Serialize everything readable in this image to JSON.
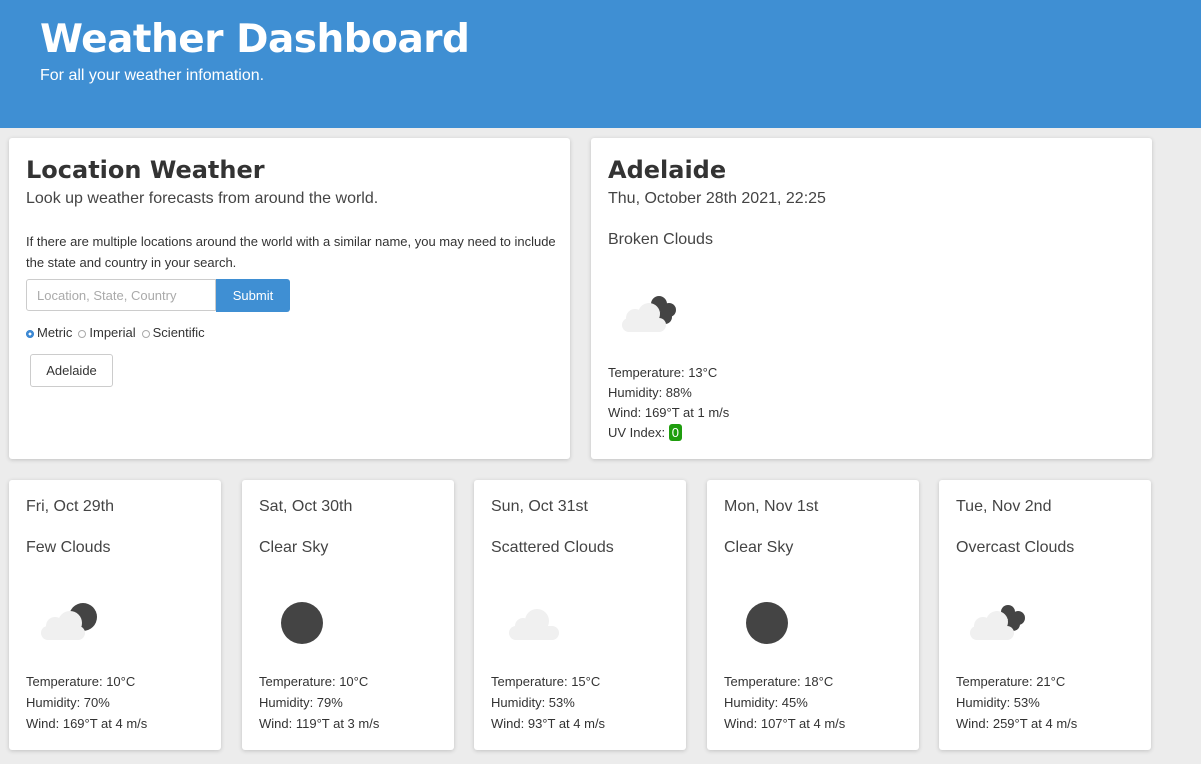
{
  "header": {
    "title": "Weather Dashboard",
    "subtitle": "For all your weather infomation."
  },
  "location_card": {
    "title": "Location Weather",
    "lead": "Look up weather forecasts from around the world.",
    "note": "If there are multiple locations around the world with a similar name, you may need to include the state and country in your search.",
    "search_placeholder": "Location, State, Country",
    "search_value": "",
    "submit_label": "Submit",
    "units": [
      {
        "label": "Metric",
        "selected": true
      },
      {
        "label": "Imperial",
        "selected": false
      },
      {
        "label": "Scientific",
        "selected": false
      }
    ],
    "history": [
      "Adelaide"
    ]
  },
  "current": {
    "city": "Adelaide",
    "datetime": "Thu, October 28th 2021, 22:25",
    "description": "Broken Clouds",
    "icon": "broken-clouds-icon",
    "temperature": "Temperature: 13°C",
    "humidity": "Humidity: 88%",
    "wind": "Wind: 169°T at 1 m/s",
    "uv_label": "UV Index:",
    "uv_value": "0",
    "uv_color": "#1f9d0e"
  },
  "forecast": [
    {
      "date": "Fri, Oct 29th",
      "description": "Few Clouds",
      "icon": "few-clouds-icon",
      "temperature": "Temperature: 10°C",
      "humidity": "Humidity: 70%",
      "wind": "Wind: 169°T at 4 m/s"
    },
    {
      "date": "Sat, Oct 30th",
      "description": "Clear Sky",
      "icon": "clear-sky-icon",
      "temperature": "Temperature: 10°C",
      "humidity": "Humidity: 79%",
      "wind": "Wind: 119°T at 3 m/s"
    },
    {
      "date": "Sun, Oct 31st",
      "description": "Scattered Clouds",
      "icon": "scattered-clouds-icon",
      "temperature": "Temperature: 15°C",
      "humidity": "Humidity: 53%",
      "wind": "Wind: 93°T at 4 m/s"
    },
    {
      "date": "Mon, Nov 1st",
      "description": "Clear Sky",
      "icon": "clear-sky-icon",
      "temperature": "Temperature: 18°C",
      "humidity": "Humidity: 45%",
      "wind": "Wind: 107°T at 4 m/s"
    },
    {
      "date": "Tue, Nov 2nd",
      "description": "Overcast Clouds",
      "icon": "overcast-clouds-icon",
      "temperature": "Temperature: 21°C",
      "humidity": "Humidity: 53%",
      "wind": "Wind: 259°T at 4 m/s"
    }
  ],
  "colors": {
    "header": "#3f8fd3",
    "button": "#3f8fd3",
    "background": "#ececec"
  }
}
